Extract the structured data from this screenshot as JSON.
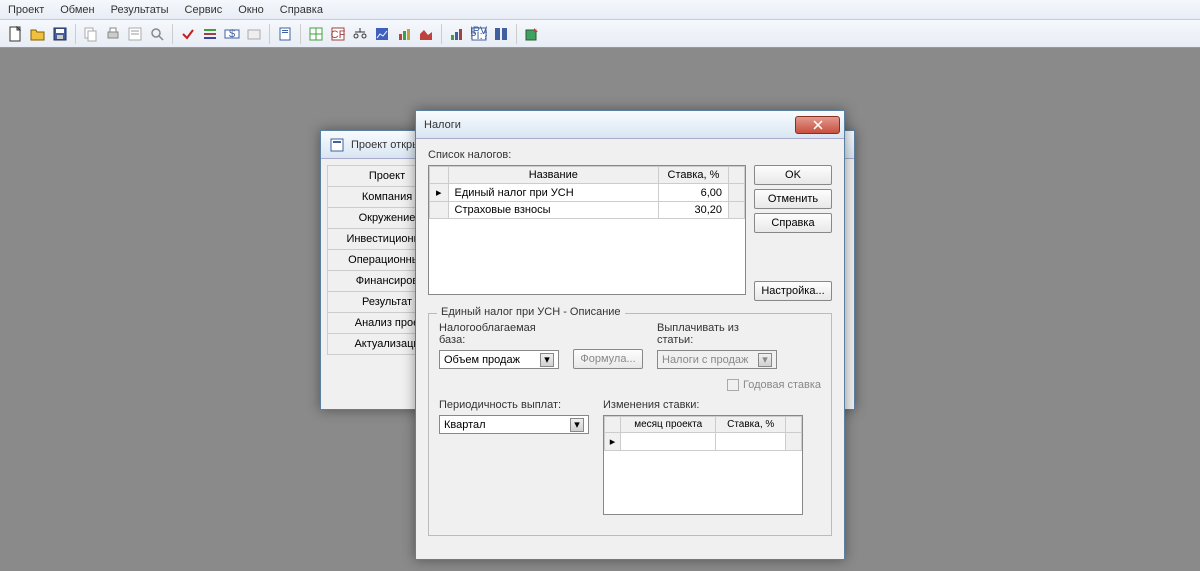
{
  "menu": [
    "Проект",
    "Обмен",
    "Результаты",
    "Сервис",
    "Окно",
    "Справка"
  ],
  "bg_window": {
    "title": "Проект откры",
    "tabs": [
      "Проект",
      "Компания",
      "Окружение",
      "Инвестиционны",
      "Операционный",
      "Финансиров",
      "Результат",
      "Анализ прое",
      "Актуализаци"
    ]
  },
  "dialog": {
    "title": "Налоги",
    "list_label": "Список налогов:",
    "columns": {
      "name": "Название",
      "rate": "Ставка, %"
    },
    "rows": [
      {
        "name": "Единый налог при УСН",
        "rate": "6,00"
      },
      {
        "name": "Страховые взносы",
        "rate": "30,20"
      }
    ],
    "buttons": {
      "ok": "OK",
      "cancel": "Отменить",
      "help": "Справка",
      "settings": "Настройка..."
    },
    "desc_title": "Единый налог при УСН - Описание",
    "base_label": "Налогооблагаемая база:",
    "base_value": "Объем продаж",
    "formula_btn": "Формула...",
    "pay_from_label": "Выплачивать из статьи:",
    "pay_from_value": "Налоги с продаж",
    "annual_rate": "Годовая ставка",
    "period_label": "Периодичность выплат:",
    "period_value": "Квартал",
    "changes_label": "Изменения ставки:",
    "changes_cols": {
      "month": "месяц проекта",
      "rate": "Ставка, %"
    }
  }
}
